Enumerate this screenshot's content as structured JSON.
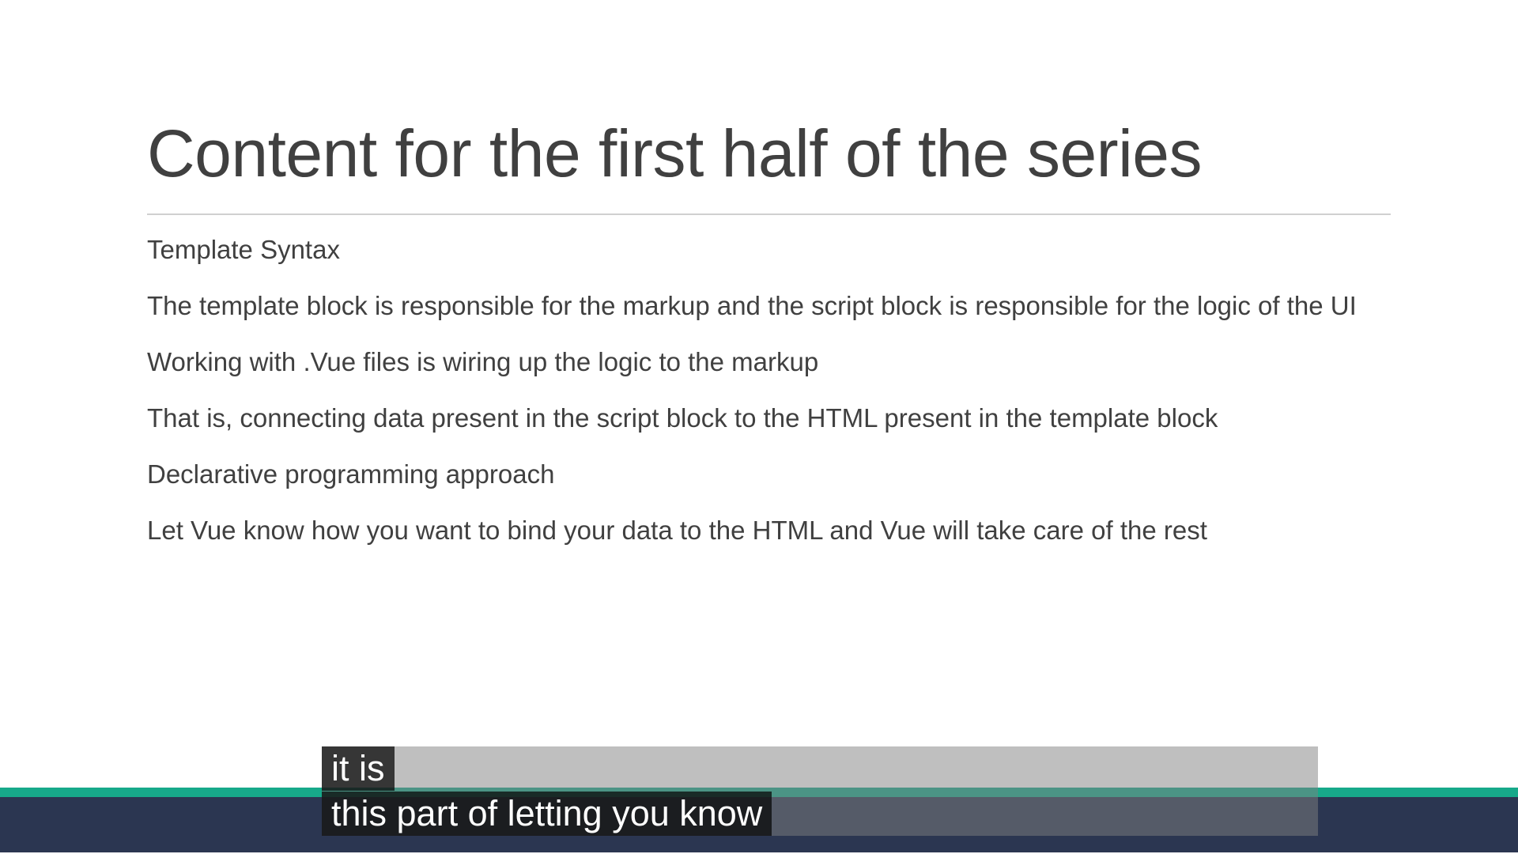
{
  "slide": {
    "title": "Content for the first half of the series",
    "bullets": [
      "Template Syntax",
      "The template block is responsible for the markup and the script block is responsible for the logic of the UI",
      "Working with .Vue files is wiring up the logic to the markup",
      "That is, connecting data present in the script block to the HTML present in the template block",
      "Declarative programming approach",
      "Let Vue know how you want to bind your data to the HTML and Vue will take care of the rest"
    ]
  },
  "captions": {
    "line1": "it is",
    "line2": "this part of letting you know"
  },
  "colors": {
    "title_text": "#404040",
    "body_text": "#404040",
    "band": "#2b3651",
    "accent": "#17a98a"
  }
}
